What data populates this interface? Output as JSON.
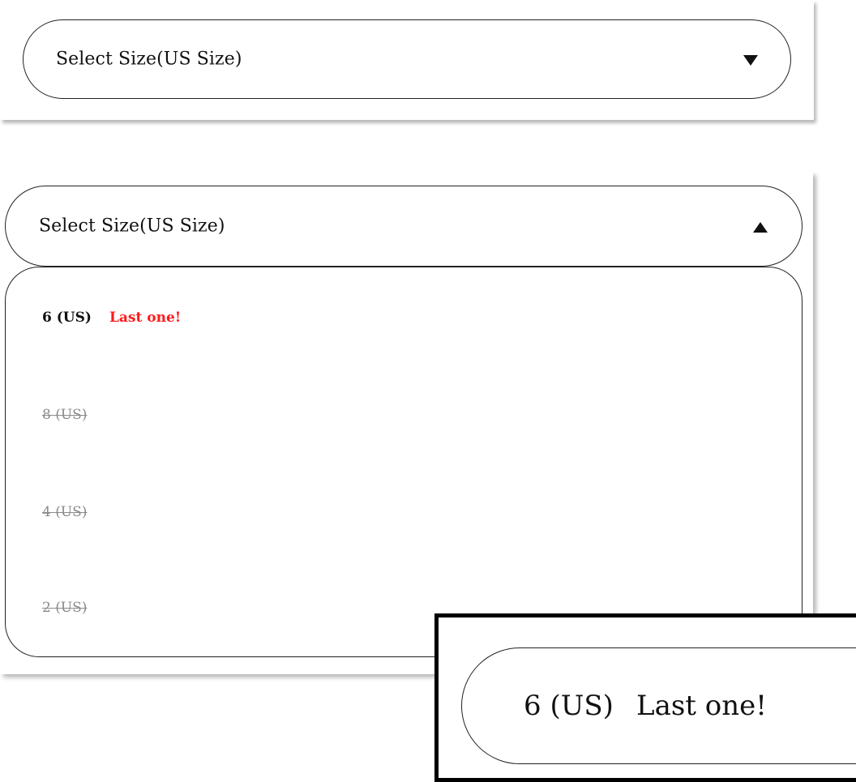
{
  "size_selector": {
    "label": "Select Size(US Size)",
    "collapsed_icon": "caret-down-icon",
    "expanded_icon": "caret-up-icon"
  },
  "options": [
    {
      "label": "6 (US)",
      "available": true,
      "note": "Last one!"
    },
    {
      "label": "8 (US)",
      "available": false
    },
    {
      "label": "4 (US)",
      "available": false
    },
    {
      "label": "2 (US)",
      "available": false
    }
  ],
  "zoom": {
    "size": "6 (US)",
    "note": "Last one!"
  },
  "colors": {
    "note_red": "#ff1a1a",
    "unavailable_gray": "#8a8a8a",
    "border": "#222222"
  }
}
